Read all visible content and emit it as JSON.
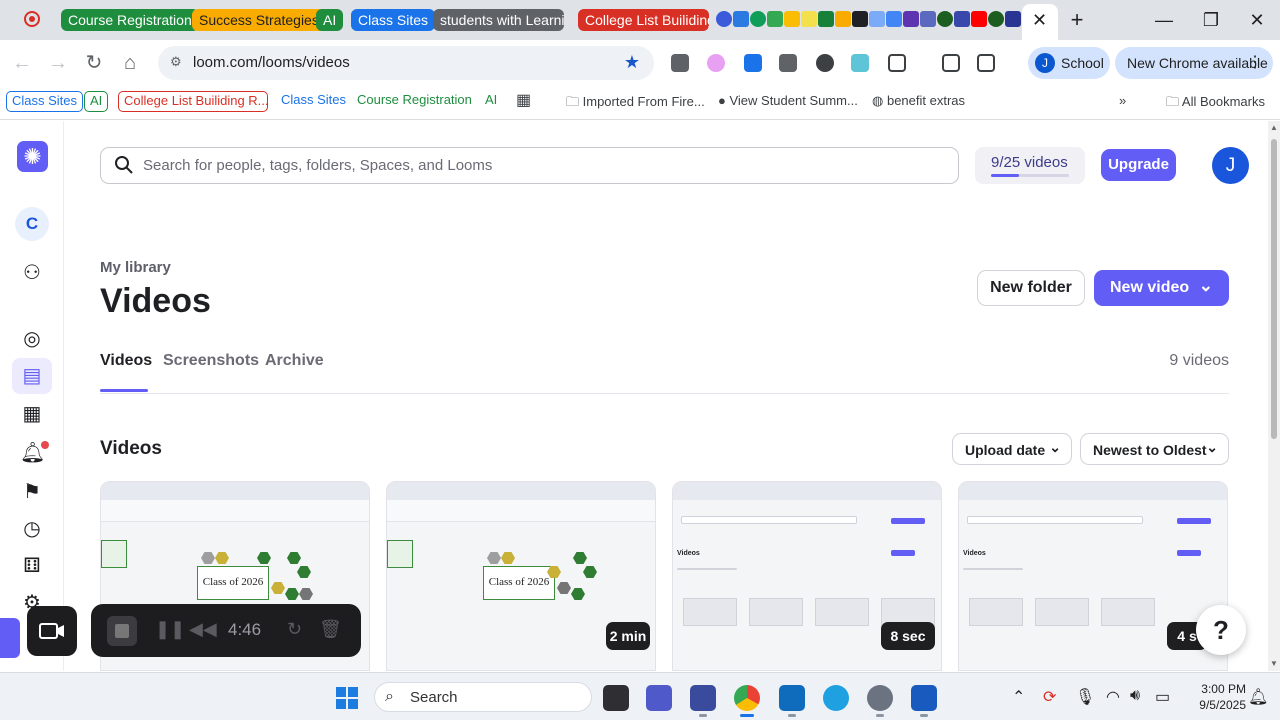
{
  "browser": {
    "tab_groups": [
      {
        "label": "Course Registration",
        "color": "#1e8e3e"
      },
      {
        "label": "Success Strategies",
        "color": "#f9ab00"
      },
      {
        "label": "AI",
        "color": "#1e8e3e"
      },
      {
        "label": "Class Sites",
        "color": "#1a73e8"
      },
      {
        "label": "students with Learning",
        "color": "#5f6368"
      },
      {
        "label": "College List Builiding",
        "color": "#d93025"
      }
    ],
    "url": "loom.com/looms/videos",
    "profile_label": "School",
    "profile_initial": "J",
    "update_label": "New Chrome available"
  },
  "bookmarks": {
    "chips": [
      {
        "label": "Class Sites",
        "color": "#1a73e8"
      },
      {
        "label": "AI",
        "color": "#1e8e3e"
      },
      {
        "label": "College List Builiding R...",
        "color": "#d93025"
      },
      {
        "label": "Class Sites",
        "color": "#1a73e8"
      },
      {
        "label": "Course Registration",
        "color": "#1e8e3e"
      },
      {
        "label": "AI",
        "color": "#1e8e3e"
      }
    ],
    "items": [
      "Imported From Fire...",
      "View Student Summ...",
      "benefit extras"
    ],
    "all_label": "All Bookmarks"
  },
  "loom": {
    "workspace_initial": "C",
    "search_placeholder": "Search for people, tags, folders, Spaces, and Looms",
    "quota_label": "9/25 videos",
    "quota_fraction": 0.36,
    "upgrade_label": "Upgrade",
    "user_initial": "J",
    "breadcrumb": "My library",
    "title": "Videos",
    "new_folder_label": "New folder",
    "new_video_label": "New video",
    "tabs": [
      "Videos",
      "Screenshots",
      "Archive"
    ],
    "count_label": "9 videos",
    "section_title": "Videos",
    "sort_field": "Upload date",
    "sort_order": "Newest to Oldest",
    "cards": [
      {
        "slide_text": "Class of 2026",
        "duration": ""
      },
      {
        "slide_text": "Class of 2026",
        "duration": "2 min"
      },
      {
        "mini_title": "Videos",
        "duration": "8 sec"
      },
      {
        "mini_title": "Videos",
        "duration": "4 s"
      }
    ],
    "recorder_time": "4:46",
    "accent": "#625df5"
  },
  "taskbar": {
    "search_label": "Search",
    "time": "3:00 PM",
    "date": "9/5/2025"
  }
}
